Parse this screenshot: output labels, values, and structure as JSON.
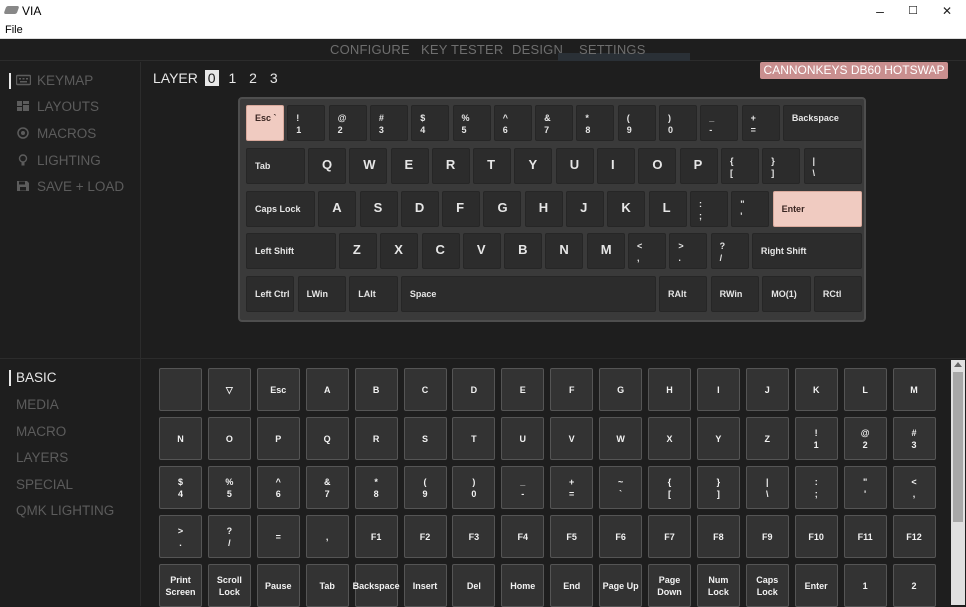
{
  "window": {
    "title": "VIA",
    "minimize": "–",
    "maximize": "☐",
    "close": "✕"
  },
  "menu": {
    "file": "File"
  },
  "topnav": {
    "tabs": [
      {
        "label": "CONFIGURE",
        "active": true
      },
      {
        "label": "KEY TESTER",
        "active": false
      },
      {
        "label": "DESIGN",
        "active": false
      },
      {
        "label": "SETTINGS",
        "active": false
      }
    ]
  },
  "device": {
    "name": "CANNONKEYS DB60 HOTSWAP",
    "color": "#c98f8f"
  },
  "sidebar": {
    "items": [
      {
        "label": "KEYMAP",
        "icon": "keyboard-icon",
        "active": true
      },
      {
        "label": "LAYOUTS",
        "icon": "layouts-icon",
        "active": false
      },
      {
        "label": "MACROS",
        "icon": "macros-icon",
        "active": false
      },
      {
        "label": "LIGHTING",
        "icon": "bulb-icon",
        "active": false
      },
      {
        "label": "SAVE + LOAD",
        "icon": "floppy-icon",
        "active": false
      }
    ]
  },
  "layers": {
    "label": "LAYER",
    "items": [
      "0",
      "1",
      "2",
      "3"
    ],
    "active": "0"
  },
  "keyboard": {
    "accent": "#f0cbc1",
    "rows": [
      [
        {
          "top": "Esc `",
          "w": 1,
          "sel": true
        },
        {
          "top": "!",
          "bot": "1"
        },
        {
          "top": "@",
          "bot": "2"
        },
        {
          "top": "#",
          "bot": "3"
        },
        {
          "top": "$",
          "bot": "4"
        },
        {
          "top": "%",
          "bot": "5"
        },
        {
          "top": "^",
          "bot": "6"
        },
        {
          "top": "&",
          "bot": "7"
        },
        {
          "top": "*",
          "bot": "8"
        },
        {
          "top": "(",
          "bot": "9"
        },
        {
          "top": ")",
          "bot": "0"
        },
        {
          "top": "_",
          "bot": "-"
        },
        {
          "top": "+",
          "bot": "="
        },
        {
          "top": "Backspace",
          "w": 2
        }
      ],
      [
        {
          "center": "Tab",
          "w": 1.5
        },
        {
          "letter": "Q"
        },
        {
          "letter": "W"
        },
        {
          "letter": "E"
        },
        {
          "letter": "R"
        },
        {
          "letter": "T"
        },
        {
          "letter": "Y"
        },
        {
          "letter": "U"
        },
        {
          "letter": "I"
        },
        {
          "letter": "O"
        },
        {
          "letter": "P"
        },
        {
          "top": "{",
          "bot": "["
        },
        {
          "top": "}",
          "bot": "]"
        },
        {
          "top": "|",
          "bot": "\\",
          "w": 1.5
        }
      ],
      [
        {
          "center": "Caps Lock",
          "w": 1.75
        },
        {
          "letter": "A"
        },
        {
          "letter": "S"
        },
        {
          "letter": "D"
        },
        {
          "letter": "F"
        },
        {
          "letter": "G"
        },
        {
          "letter": "H"
        },
        {
          "letter": "J"
        },
        {
          "letter": "K"
        },
        {
          "letter": "L"
        },
        {
          "top": ":",
          "bot": ";"
        },
        {
          "top": "\"",
          "bot": "'"
        },
        {
          "center": "Enter",
          "w": 2.25,
          "sel": true
        }
      ],
      [
        {
          "center": "Left Shift",
          "w": 2.25
        },
        {
          "letter": "Z"
        },
        {
          "letter": "X"
        },
        {
          "letter": "C"
        },
        {
          "letter": "V"
        },
        {
          "letter": "B"
        },
        {
          "letter": "N"
        },
        {
          "letter": "M"
        },
        {
          "top": "<",
          "bot": ","
        },
        {
          "top": ">",
          "bot": "."
        },
        {
          "top": "?",
          "bot": "/"
        },
        {
          "center": "Right Shift",
          "w": 2.75
        }
      ],
      [
        {
          "center": "Left Ctrl",
          "w": 1.25
        },
        {
          "center": "LWin",
          "w": 1.25
        },
        {
          "center": "LAlt",
          "w": 1.25
        },
        {
          "center": "Space",
          "w": 6.25
        },
        {
          "center": "RAlt",
          "w": 1.25
        },
        {
          "center": "RWin",
          "w": 1.25
        },
        {
          "center": "MO(1)",
          "w": 1.25
        },
        {
          "center": "RCtl",
          "w": 1.25
        }
      ]
    ]
  },
  "categories": {
    "items": [
      {
        "label": "BASIC",
        "active": true
      },
      {
        "label": "MEDIA",
        "active": false
      },
      {
        "label": "MACRO",
        "active": false
      },
      {
        "label": "LAYERS",
        "active": false
      },
      {
        "label": "SPECIAL",
        "active": false
      },
      {
        "label": "QMK LIGHTING",
        "active": false
      }
    ]
  },
  "palette": {
    "rows": [
      [
        "",
        "▽",
        "Esc",
        "A",
        "B",
        "C",
        "D",
        "E",
        "F",
        "G",
        "H",
        "I",
        "J",
        "K",
        "L",
        "M"
      ],
      [
        "N",
        "O",
        "P",
        "Q",
        "R",
        "S",
        "T",
        "U",
        "V",
        "W",
        "X",
        "Y",
        "Z",
        "!\n1",
        "@\n2",
        "#\n3"
      ],
      [
        "$\n4",
        "%\n5",
        "^\n6",
        "&\n7",
        "*\n8",
        "(\n9",
        ")\n0",
        "_\n-",
        "+\n=",
        "~\n`",
        "{\n[",
        "}\n]",
        "|\n\\",
        ":\n;",
        "\"\n'",
        "<\n,"
      ],
      [
        ">\n.",
        "?\n/",
        "=",
        ",",
        "F1",
        "F2",
        "F3",
        "F4",
        "F5",
        "F6",
        "F7",
        "F8",
        "F9",
        "F10",
        "F11",
        "F12"
      ],
      [
        "Print\nScreen",
        "Scroll\nLock",
        "Pause",
        "Tab",
        "Backspace",
        "Insert",
        "Del",
        "Home",
        "End",
        "Page Up",
        "Page\nDown",
        "Num\nLock",
        "Caps\nLock",
        "Enter",
        "1",
        "2"
      ]
    ]
  }
}
